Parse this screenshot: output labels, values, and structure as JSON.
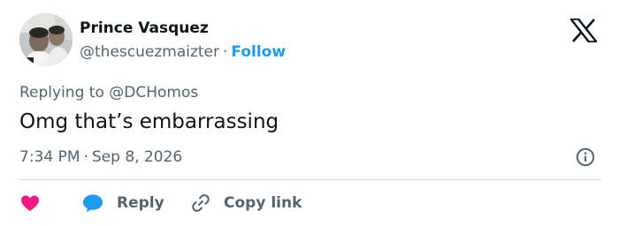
{
  "author": {
    "name": "Prince Vasquez",
    "handle": "@thescuezmaizter",
    "separator": "·",
    "follow_label": "Follow"
  },
  "reply_context": {
    "prefix": "Replying to",
    "mention": "@DCHomos"
  },
  "tweet": {
    "text": "Omg that’s embarrassing",
    "time": "7:34 PM",
    "separator": "·",
    "date": "Sep 8, 2026"
  },
  "actions": {
    "like_icon": "heart-icon",
    "reply_label": "Reply",
    "reply_icon": "speech-bubble-icon",
    "copy_label": "Copy link",
    "copy_icon": "link-icon"
  },
  "icons": {
    "platform_logo": "x-logo-icon",
    "info": "info-icon"
  },
  "colors": {
    "text_primary": "#0f1419",
    "text_secondary": "#536471",
    "accent_blue": "#1d9bf0",
    "like_pink": "#f91880",
    "divider": "#cfd9de"
  }
}
